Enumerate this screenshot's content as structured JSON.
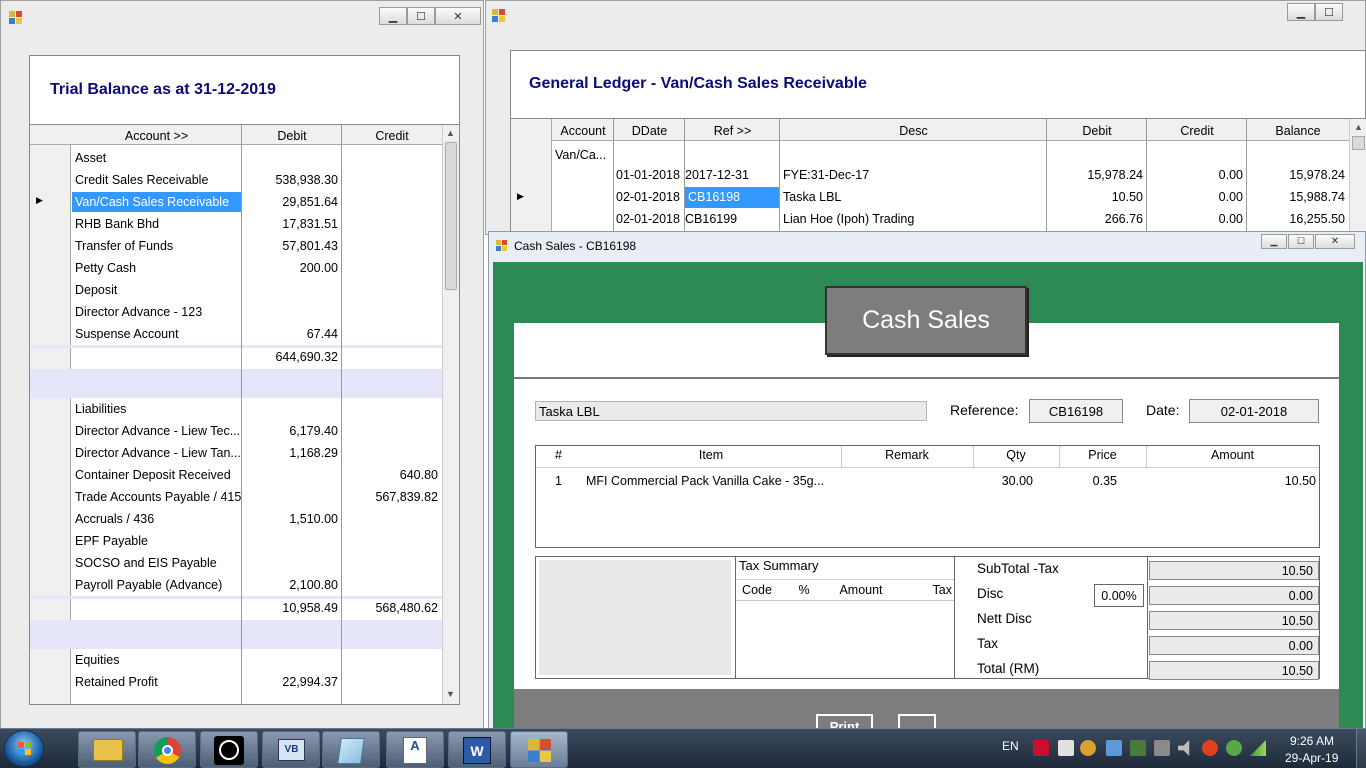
{
  "left_window": {
    "title": "Trial Balance as at 31-12-2019",
    "columns": [
      "Account >>",
      "Debit",
      "Credit"
    ],
    "rows": [
      {
        "account": "Asset",
        "debit": "",
        "credit": ""
      },
      {
        "account": "Credit Sales Receivable",
        "debit": "538,938.30",
        "credit": ""
      },
      {
        "account": "Van/Cash Sales Receivable",
        "debit": "29,851.64",
        "credit": "",
        "selected": true
      },
      {
        "account": "RHB Bank Bhd",
        "debit": "17,831.51",
        "credit": ""
      },
      {
        "account": "Transfer of Funds",
        "debit": "57,801.43",
        "credit": ""
      },
      {
        "account": "Petty Cash",
        "debit": "200.00",
        "credit": ""
      },
      {
        "account": "Deposit",
        "debit": "",
        "credit": ""
      },
      {
        "account": "Director Advance - 123",
        "debit": "",
        "credit": ""
      },
      {
        "account": "Suspense Account",
        "debit": "67.44",
        "credit": ""
      },
      {
        "account": "",
        "debit": "644,690.32",
        "credit": "",
        "subtotal": true
      },
      {
        "account": "",
        "debit": "",
        "credit": "",
        "band": true
      },
      {
        "account": "Liabilities",
        "debit": "",
        "credit": ""
      },
      {
        "account": "Director Advance - Liew Tec...",
        "debit": "6,179.40",
        "credit": ""
      },
      {
        "account": "Director Advance - Liew Tan...",
        "debit": "1,168.29",
        "credit": ""
      },
      {
        "account": "Container Deposit Received",
        "debit": "",
        "credit": "640.80"
      },
      {
        "account": "Trade Accounts Payable / 415",
        "debit": "",
        "credit": "567,839.82"
      },
      {
        "account": "Accruals / 436",
        "debit": "1,510.00",
        "credit": ""
      },
      {
        "account": "EPF Payable",
        "debit": "",
        "credit": ""
      },
      {
        "account": "SOCSO and EIS Payable",
        "debit": "",
        "credit": ""
      },
      {
        "account": "Payroll Payable (Advance)",
        "debit": "2,100.80",
        "credit": ""
      },
      {
        "account": "",
        "debit": "10,958.49",
        "credit": "568,480.62",
        "subtotal": true
      },
      {
        "account": "",
        "debit": "",
        "credit": "",
        "band": true
      },
      {
        "account": "Equities",
        "debit": "",
        "credit": ""
      },
      {
        "account": "Retained Profit",
        "debit": "22,994.37",
        "credit": ""
      }
    ]
  },
  "right_window": {
    "title": "General Ledger - Van/Cash Sales Receivable",
    "columns": [
      "Account",
      "DDate",
      "Ref >>",
      "Desc",
      "Debit",
      "Credit",
      "Balance"
    ],
    "account_cell": "Van/Ca...",
    "rows": [
      {
        "date": "01-01-2018",
        "ref": "2017-12-31",
        "desc": "FYE:31-Dec-17",
        "debit": "15,978.24",
        "credit": "0.00",
        "balance": "15,978.24"
      },
      {
        "date": "02-01-2018",
        "ref": "CB16198",
        "desc": "Taska LBL",
        "debit": "10.50",
        "credit": "0.00",
        "balance": "15,988.74",
        "selected": true
      },
      {
        "date": "02-01-2018",
        "ref": "CB16199",
        "desc": "Lian Hoe (Ipoh) Trading",
        "debit": "266.76",
        "credit": "0.00",
        "balance": "16,255.50"
      }
    ]
  },
  "cash_window": {
    "title": "Cash Sales - CB16198",
    "banner": "Cash Sales",
    "customer": "Taska LBL",
    "reference_label": "Reference:",
    "reference": "CB16198",
    "date_label": "Date:",
    "date": "02-01-2018",
    "item_columns": [
      "#",
      "Item",
      "Remark",
      "Qty",
      "Price",
      "Amount"
    ],
    "items": [
      {
        "no": "1",
        "item": "MFI Commercial Pack Vanilla Cake - 35g...",
        "remark": "",
        "qty": "30.00",
        "price": "0.35",
        "amount": "10.50"
      }
    ],
    "tax_summary_title": "Tax Summary",
    "tax_columns": [
      "Code",
      "%",
      "Amount",
      "Tax"
    ],
    "totals": {
      "subtotal_label": "SubTotal -Tax",
      "subtotal": "10.50",
      "disc_label": "Disc",
      "disc_pct": "0.00%",
      "disc": "0.00",
      "nett_label": "Nett Disc",
      "nett": "10.50",
      "tax_label": "Tax",
      "tax": "0.00",
      "total_label": "Total (RM)",
      "total": "10.50"
    },
    "print_button": "Print"
  },
  "taskbar": {
    "language": "EN",
    "time": "9:26 AM",
    "date": "29-Apr-19",
    "apps": [
      "windows-explorer",
      "chrome",
      "clock-app",
      "visual-basic",
      "notepad",
      "wordpad",
      "word",
      "accounting-app"
    ]
  },
  "colors": {
    "title_blue": "#0b0b7a",
    "selection": "#3399ff",
    "green_frame": "#2e8a55",
    "subtotal_band": "#e6e6fa"
  }
}
